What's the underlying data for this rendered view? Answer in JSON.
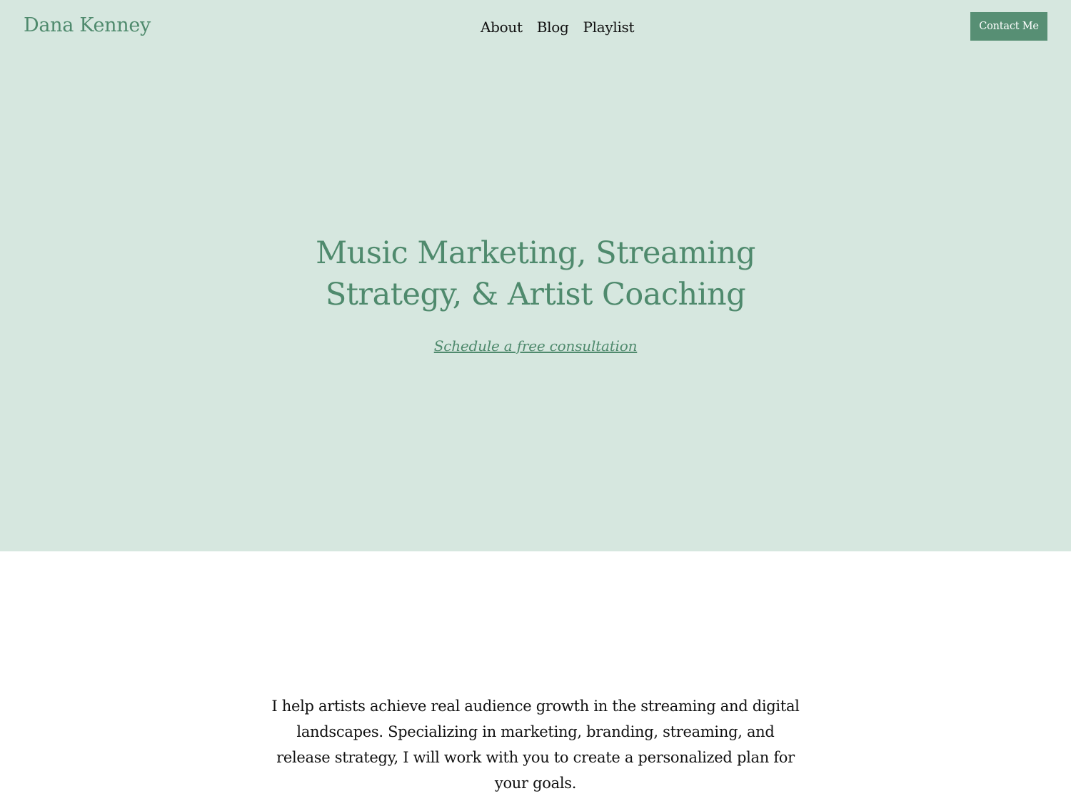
{
  "header": {
    "brand": "Dana Kenney",
    "nav": [
      {
        "label": "About"
      },
      {
        "label": "Blog"
      },
      {
        "label": "Playlist"
      }
    ],
    "contact_button": "Contact Me"
  },
  "hero": {
    "headline": "Music Marketing, Streaming Strategy, & Artist Coaching",
    "cta_link": "Schedule a free consultation",
    "background_color": "#d6e7df",
    "accent_color": "#4f8a6d"
  },
  "intro": {
    "text": "I help artists achieve real audience growth in the streaming and digital landscapes. Specializing in marketing, branding, streaming, and release strategy, I will work with you to create a personalized plan for your goals."
  }
}
